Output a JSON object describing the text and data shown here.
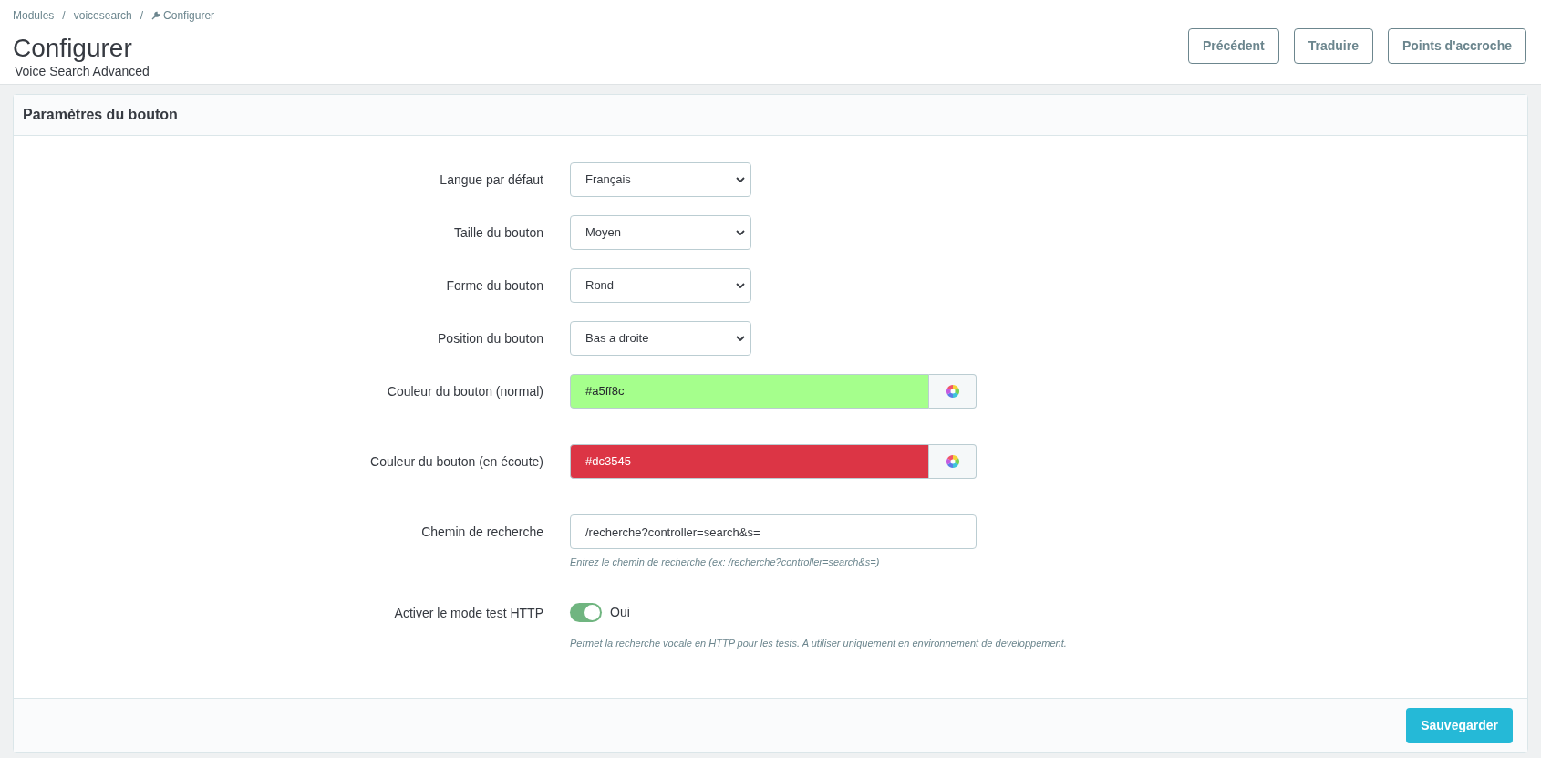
{
  "breadcrumb": [
    {
      "kind": "link",
      "text": "Modules"
    },
    {
      "kind": "separator",
      "text": "/"
    },
    {
      "kind": "link",
      "text": "voicesearch"
    },
    {
      "kind": "separator",
      "text": "/"
    },
    {
      "kind": "current",
      "text": "Configurer"
    }
  ],
  "header": {
    "title": "Configurer",
    "subtitle": "Voice Search Advanced",
    "buttons": [
      "Précédent",
      "Traduire",
      "Points d'accroche"
    ]
  },
  "panel": {
    "title": "Paramètres du bouton",
    "fields": [
      {
        "kind": "select",
        "label": "Langue par défaut",
        "value": "Français"
      },
      {
        "kind": "select",
        "label": "Taille du bouton",
        "value": "Moyen"
      },
      {
        "kind": "select",
        "label": "Forme du bouton",
        "value": "Rond"
      },
      {
        "kind": "select",
        "label": "Position du bouton",
        "value": "Bas a droite"
      },
      {
        "kind": "color",
        "label": "Couleur du bouton (normal)",
        "value": "#a5ff8c",
        "color": "#a5ff8c"
      },
      {
        "kind": "color",
        "label": "Couleur du bouton (en écoute)",
        "value": "#dc3545",
        "color": "#dc3545"
      },
      {
        "kind": "text",
        "label": "Chemin de recherche",
        "value": "/recherche?controller=search&s=",
        "help": "Entrez le chemin de recherche (ex: /recherche?controller=search&s=)"
      },
      {
        "kind": "switch",
        "label": "Activer le mode test HTTP",
        "on": true,
        "state_label": "Oui",
        "help": "Permet la recherche vocale en HTTP pour les tests. A utiliser uniquement en environnement de developpement."
      }
    ],
    "save_button": "Sauvegarder"
  }
}
